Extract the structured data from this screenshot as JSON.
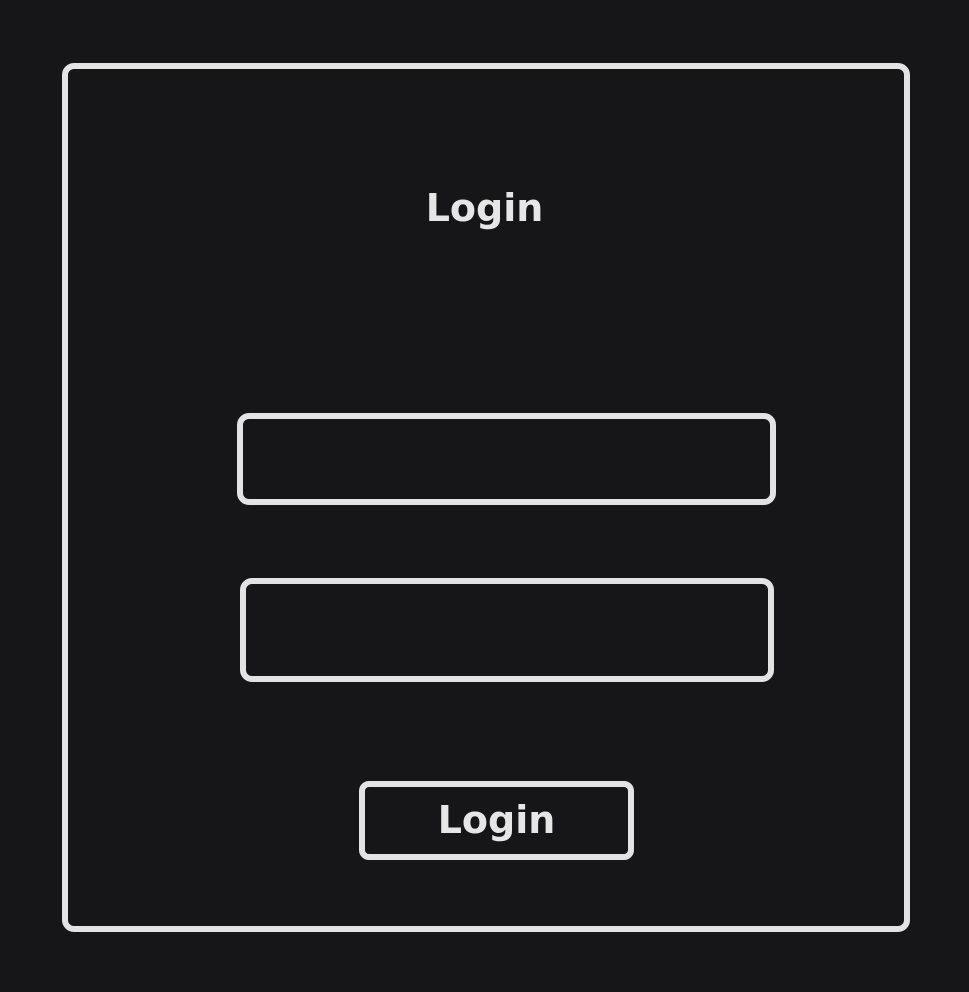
{
  "title": "Login",
  "button_label": "Login"
}
